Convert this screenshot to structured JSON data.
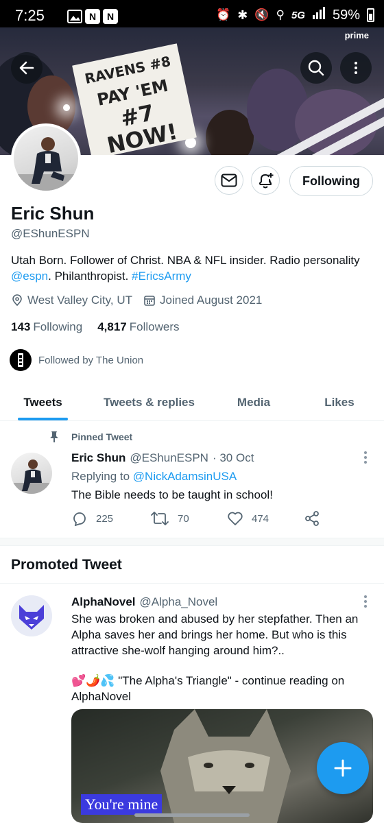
{
  "status_bar": {
    "time": "7:25",
    "network": "5G",
    "battery": "59%"
  },
  "banner": {
    "sign_lines": [
      "RAVENS #8",
      "PAY 'EM",
      "#7 NOW!"
    ],
    "prime_label": "prime",
    "back_icon": "arrow-left-icon",
    "search_icon": "search-icon"
  },
  "profile": {
    "name": "Eric Shun",
    "handle": "@EShunESPN",
    "bio_prefix": "Utah Born. Follower of Christ. NBA & NFL insider. Radio personality ",
    "bio_link_espn": "@espn",
    "bio_middle": ". Philanthropist. ",
    "bio_hashtag": "#EricsArmy",
    "location": "West Valley City, UT",
    "joined": "Joined August 2021",
    "following_count": "143",
    "following_label": "Following",
    "followers_count": "4,817",
    "followers_label": "Followers",
    "followed_by": "Followed by The Union",
    "following_button": "Following"
  },
  "tabs": [
    {
      "label": "Tweets",
      "active": true
    },
    {
      "label": "Tweets & replies",
      "active": false
    },
    {
      "label": "Media",
      "active": false
    },
    {
      "label": "Likes",
      "active": false
    }
  ],
  "pinned_tweet": {
    "pinned_label": "Pinned Tweet",
    "name": "Eric Shun",
    "handle": "@EShunESPN",
    "date": "· 30 Oct",
    "replying_prefix": "Replying to ",
    "replying_to": "@NickAdamsinUSA",
    "text": "The Bible needs to be taught in school!",
    "replies": "225",
    "retweets": "70",
    "likes": "474"
  },
  "promoted": {
    "section_title": "Promoted Tweet",
    "name": "AlphaNovel",
    "handle": "@Alpha_Novel",
    "text": "She was broken and abused by her stepfather. Then an Alpha saves her and brings her home. But who is this attractive she-wolf hanging around him?..",
    "emoji_line_emojis": "💕🌶️💦",
    "emoji_line_text": " \"The Alpha's Triangle\" - continue reading on AlphaNovel",
    "media_caption": "You're mine"
  },
  "colors": {
    "accent": "#1d9bf0",
    "secondary_text": "#536471",
    "primary_text": "#0f1419"
  }
}
